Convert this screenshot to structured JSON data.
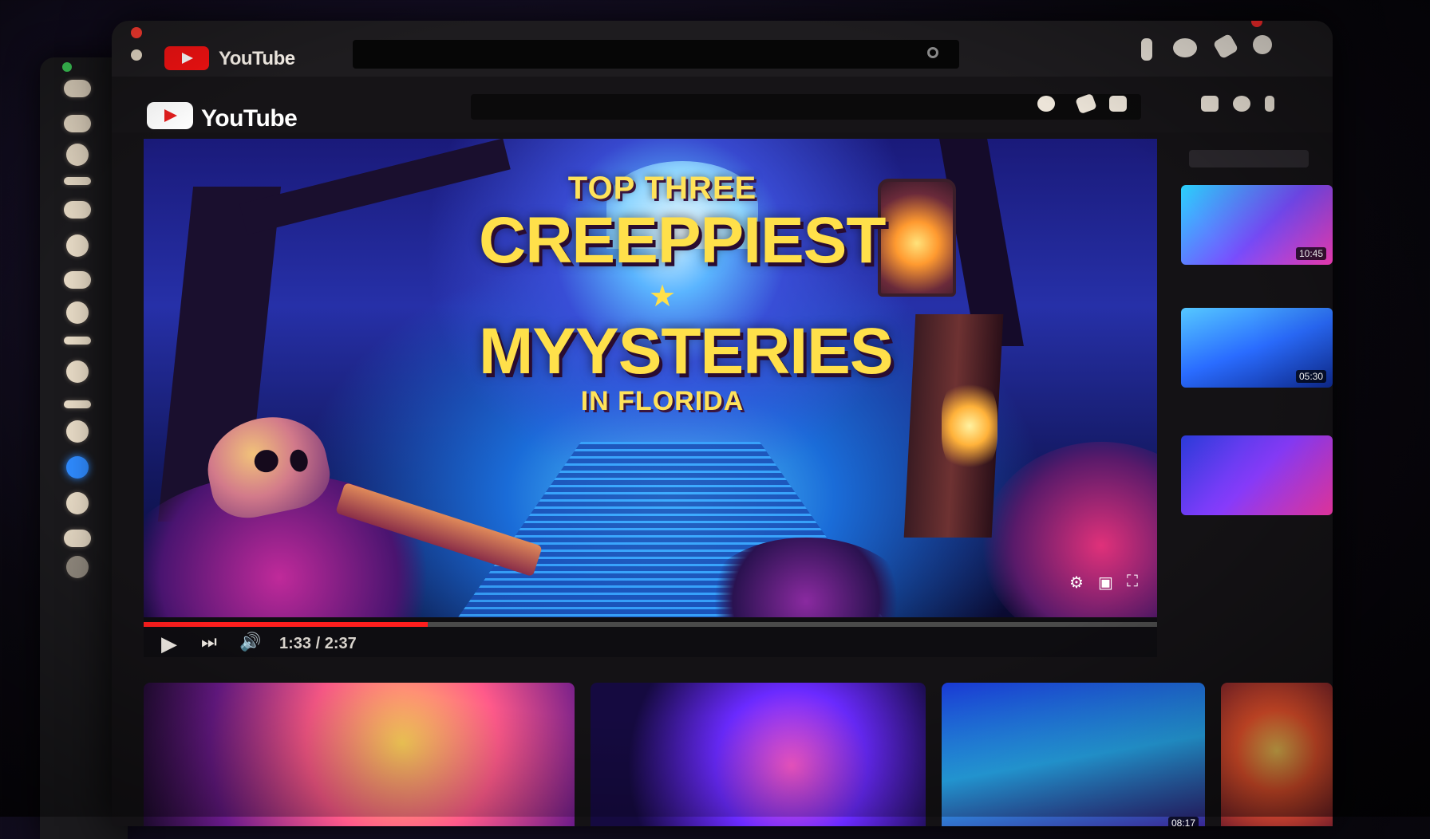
{
  "browser": {
    "tab_brand": "YouTube",
    "address": ""
  },
  "page": {
    "brand": "YouTube"
  },
  "video": {
    "title_line1": "TOP THREE",
    "title_line2": "CREEPPIEST",
    "title_star": "★",
    "title_line3": "MYYSTERIES",
    "title_line4": "IN FLORIDA",
    "current_time": "1:33 / 2:37",
    "progress": 0.28
  },
  "sidebar": {
    "header": "",
    "items": [
      {
        "title": "",
        "duration": "10:45"
      },
      {
        "title": "",
        "duration": "05:30"
      },
      {
        "title": "",
        "duration": ""
      }
    ]
  },
  "bottom": {
    "items": [
      {
        "duration": ""
      },
      {
        "duration": ""
      },
      {
        "duration": "08:17"
      },
      {
        "duration": ""
      }
    ]
  },
  "colors": {
    "brand_red": "#f31212",
    "progress_red": "#ff1e1e",
    "title_yellow": "#ffe04a"
  },
  "icons": {
    "play": "play-icon",
    "next": "next-icon",
    "volume": "volume-icon",
    "settings": "settings-icon",
    "theater": "theater-icon",
    "fullscreen": "fullscreen-icon"
  }
}
